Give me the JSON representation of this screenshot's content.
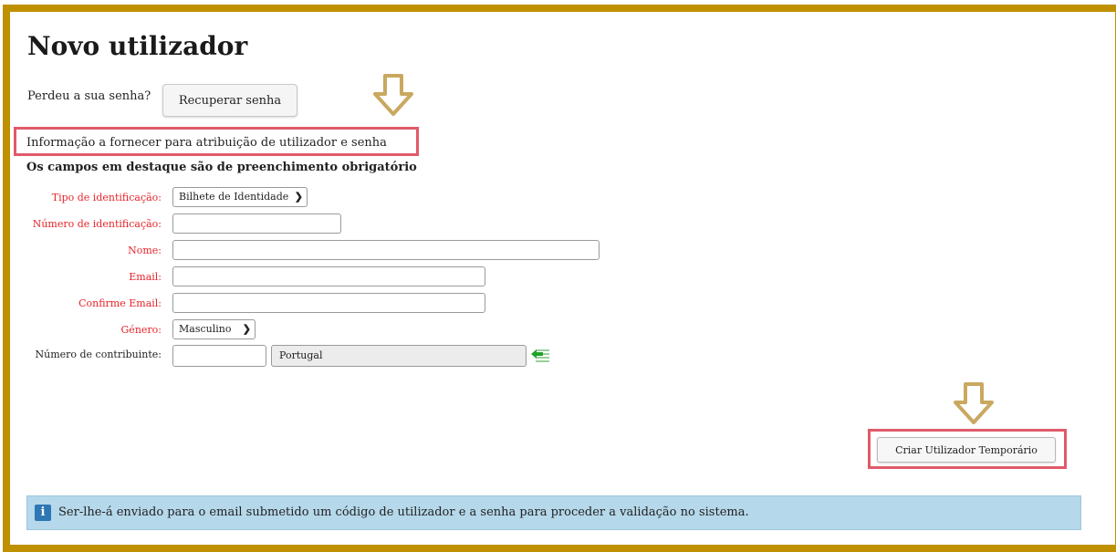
{
  "page": {
    "title": "Novo utilizador"
  },
  "lost_password": {
    "text": "Perdeu a sua senha?",
    "button": "Recuperar senha"
  },
  "info": {
    "text": "Informação a fornecer para atribuição de utilizador e senha"
  },
  "required_note": "Os campos em destaque são de preenchimento obrigatório",
  "form": {
    "tipo_label": "Tipo de identificação:",
    "tipo_value": "Bilhete de Identidade",
    "numero_label": "Número de identificação:",
    "numero_value": "",
    "nome_label": "Nome:",
    "nome_value": "",
    "email_label": "Email:",
    "email_value": "",
    "confirm_label": "Confirme Email:",
    "confirm_value": "",
    "genero_label": "Género:",
    "genero_value": "Masculino",
    "contribuinte_label": "Número de contribuinte:",
    "contribuinte_value": "",
    "country_value": "Portugal"
  },
  "create_button": "Criar Utilizador Temporário",
  "notice": {
    "icon": "info-icon",
    "text": "Ser-lhe-á enviado para o email submetido um código de utilizador e a senha para proceder a validação no sistema."
  },
  "colors": {
    "frame": "#bf9000",
    "highlight": "#e05a6a",
    "required_label": "#e8242a",
    "notice_bg": "#b5d8ea",
    "arrow": "#c9a860"
  }
}
